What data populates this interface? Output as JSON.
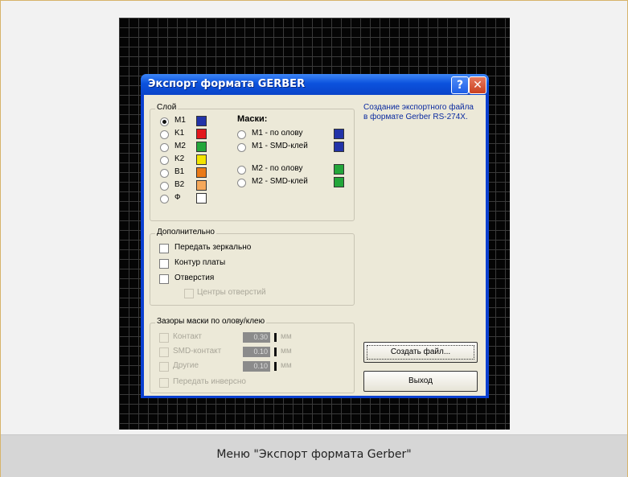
{
  "window": {
    "title": "Экспорт формата GERBER",
    "help_glyph": "?",
    "close_glyph": "✕"
  },
  "layers": {
    "legend": "Слой",
    "items": [
      {
        "label": "M1",
        "color": "#2233a8",
        "selected": true
      },
      {
        "label": "K1",
        "color": "#e2171d",
        "selected": false
      },
      {
        "label": "M2",
        "color": "#23a63a",
        "selected": false
      },
      {
        "label": "K2",
        "color": "#f2e400",
        "selected": false
      },
      {
        "label": "B1",
        "color": "#ea7a17",
        "selected": false
      },
      {
        "label": "B2",
        "color": "#f5a85a",
        "selected": false
      },
      {
        "label": "Ф",
        "color": "#ffffff",
        "selected": false
      }
    ]
  },
  "masks": {
    "heading": "Маски:",
    "items": [
      {
        "label": "M1 - по олову",
        "color": "#2233a8"
      },
      {
        "label": "M1 - SMD-клей",
        "color": "#2233a8"
      },
      {
        "label": "M2 - по олову",
        "color": "#23a63a"
      },
      {
        "label": "M2 - SMD-клей",
        "color": "#23a63a"
      }
    ]
  },
  "extra": {
    "legend": "Дополнительно",
    "mirror_label": "Передать зеркально",
    "outline_label": "Контур платы",
    "holes_label": "Отверстия",
    "hole_centers_label": "Центры отверстий"
  },
  "gaps": {
    "legend": "Зазоры маски по олову/клею",
    "rows": [
      {
        "label": "Контакт",
        "value": "0.30",
        "unit": "мм"
      },
      {
        "label": "SMD-контакт",
        "value": "0.10",
        "unit": "мм"
      },
      {
        "label": "Другие",
        "value": "0.10",
        "unit": "мм"
      }
    ],
    "invert_label": "Передать инверсно"
  },
  "description": "Создание экспортного файла в формате Gerber RS-274X.",
  "buttons": {
    "create": "Создать файл...",
    "exit": "Выход"
  },
  "caption": "Меню \"Экспорт формата Gerber\""
}
